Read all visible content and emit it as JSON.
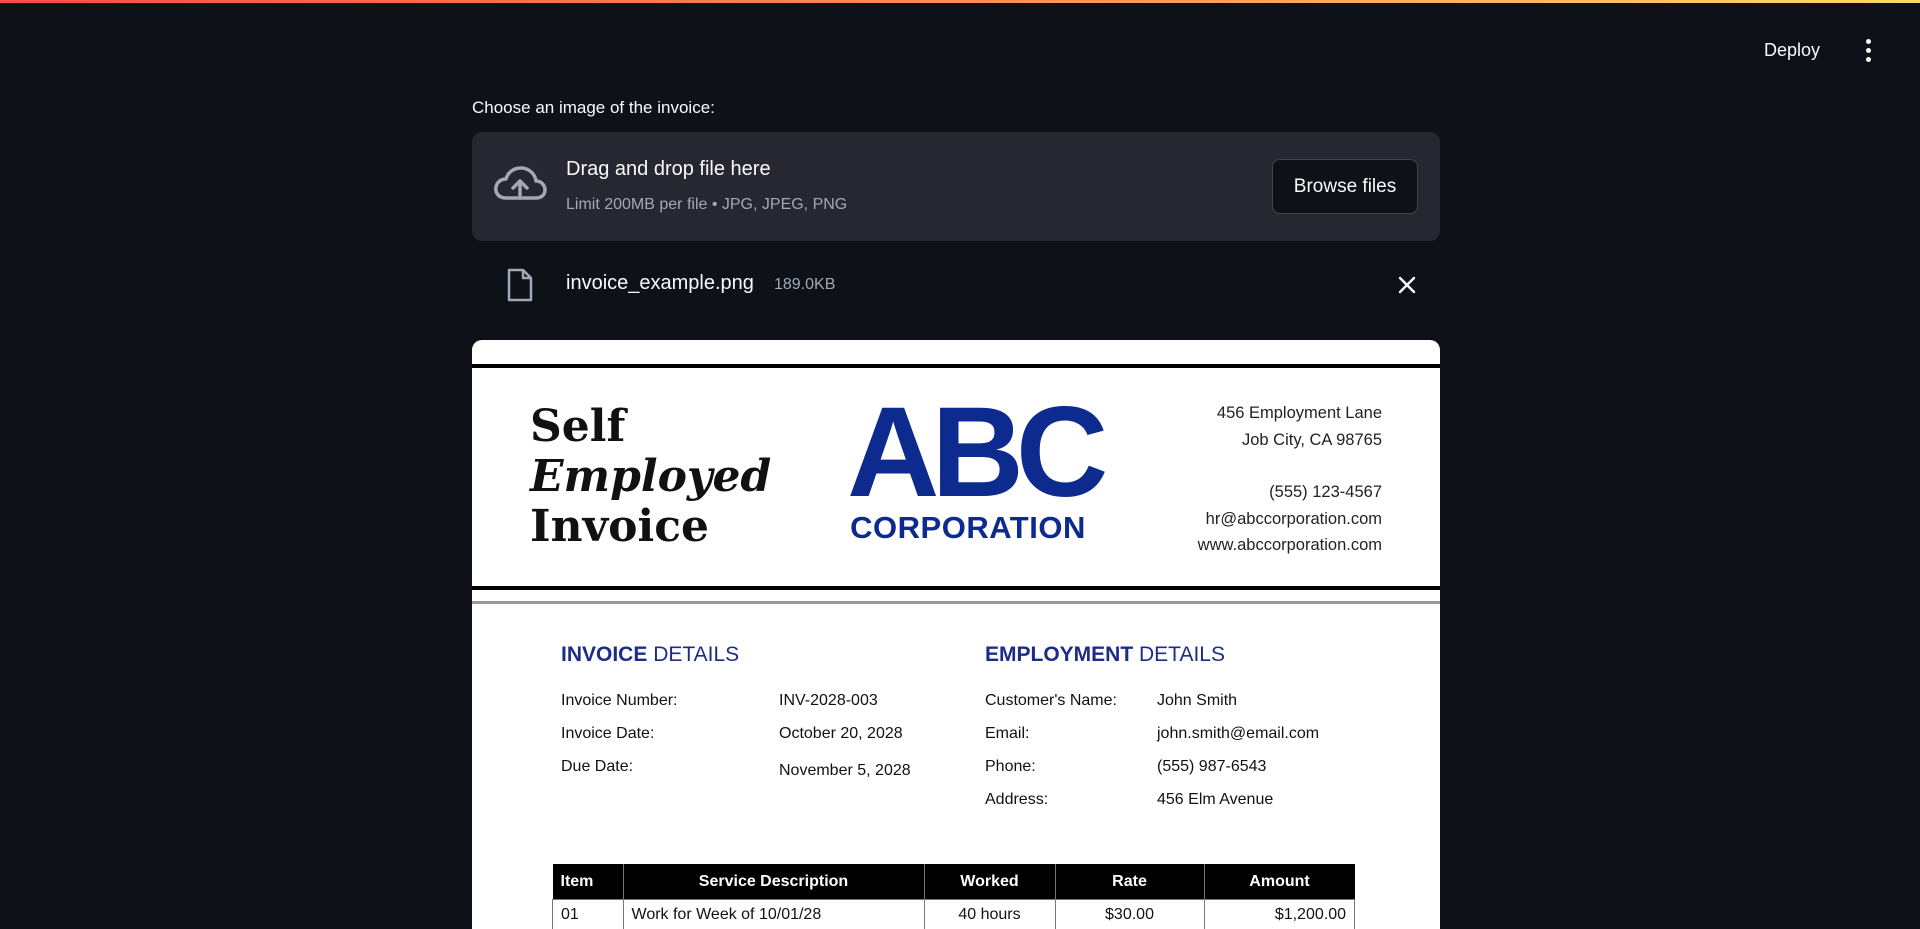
{
  "header": {
    "deploy_label": "Deploy"
  },
  "uploader": {
    "label": "Choose an image of the invoice:",
    "drop_title": "Drag and drop file here",
    "limit_text": "Limit 200MB per file • JPG, JPEG, PNG",
    "browse_label": "Browse files",
    "icon": "cloud-upload-icon"
  },
  "file": {
    "name": "invoice_example.png",
    "size": "189.0KB",
    "icon": "file-icon"
  },
  "invoice": {
    "title": [
      "Self",
      "Employed",
      "Invoice"
    ],
    "logo": {
      "letters": "ABC",
      "subtitle": "CORPORATION",
      "color": "#0d2a8f"
    },
    "contact": [
      "456 Employment Lane",
      "Job City, CA 98765",
      "(555) 123-4567",
      "hr@abccorporation.com",
      "www.abccorporation.com"
    ],
    "invoice_details": {
      "heading_bold": "INVOICE",
      "heading_rest": " DETAILS",
      "rows": [
        {
          "label": "Invoice Number:",
          "value": "INV-2028-003"
        },
        {
          "label": "Invoice Date:",
          "value": "October 20, 2028"
        },
        {
          "label": "Due Date:",
          "value": "November 5, 2028"
        }
      ]
    },
    "employment_details": {
      "heading_bold": "EMPLOYMENT",
      "heading_rest": " DETAILS",
      "rows": [
        {
          "label": "Customer's Name:",
          "value": "John Smith"
        },
        {
          "label": "Email:",
          "value": "john.smith@email.com"
        },
        {
          "label": "Phone:",
          "value": "(555) 987-6543"
        },
        {
          "label": "Address:",
          "value": "456 Elm Avenue"
        }
      ]
    },
    "table": {
      "headers": [
        "Item",
        "Service Description",
        "Worked",
        "Rate",
        "Amount"
      ],
      "rows": [
        [
          "01",
          "Work for Week of 10/01/28",
          "40 hours",
          "$30.00",
          "$1,200.00"
        ]
      ]
    }
  }
}
